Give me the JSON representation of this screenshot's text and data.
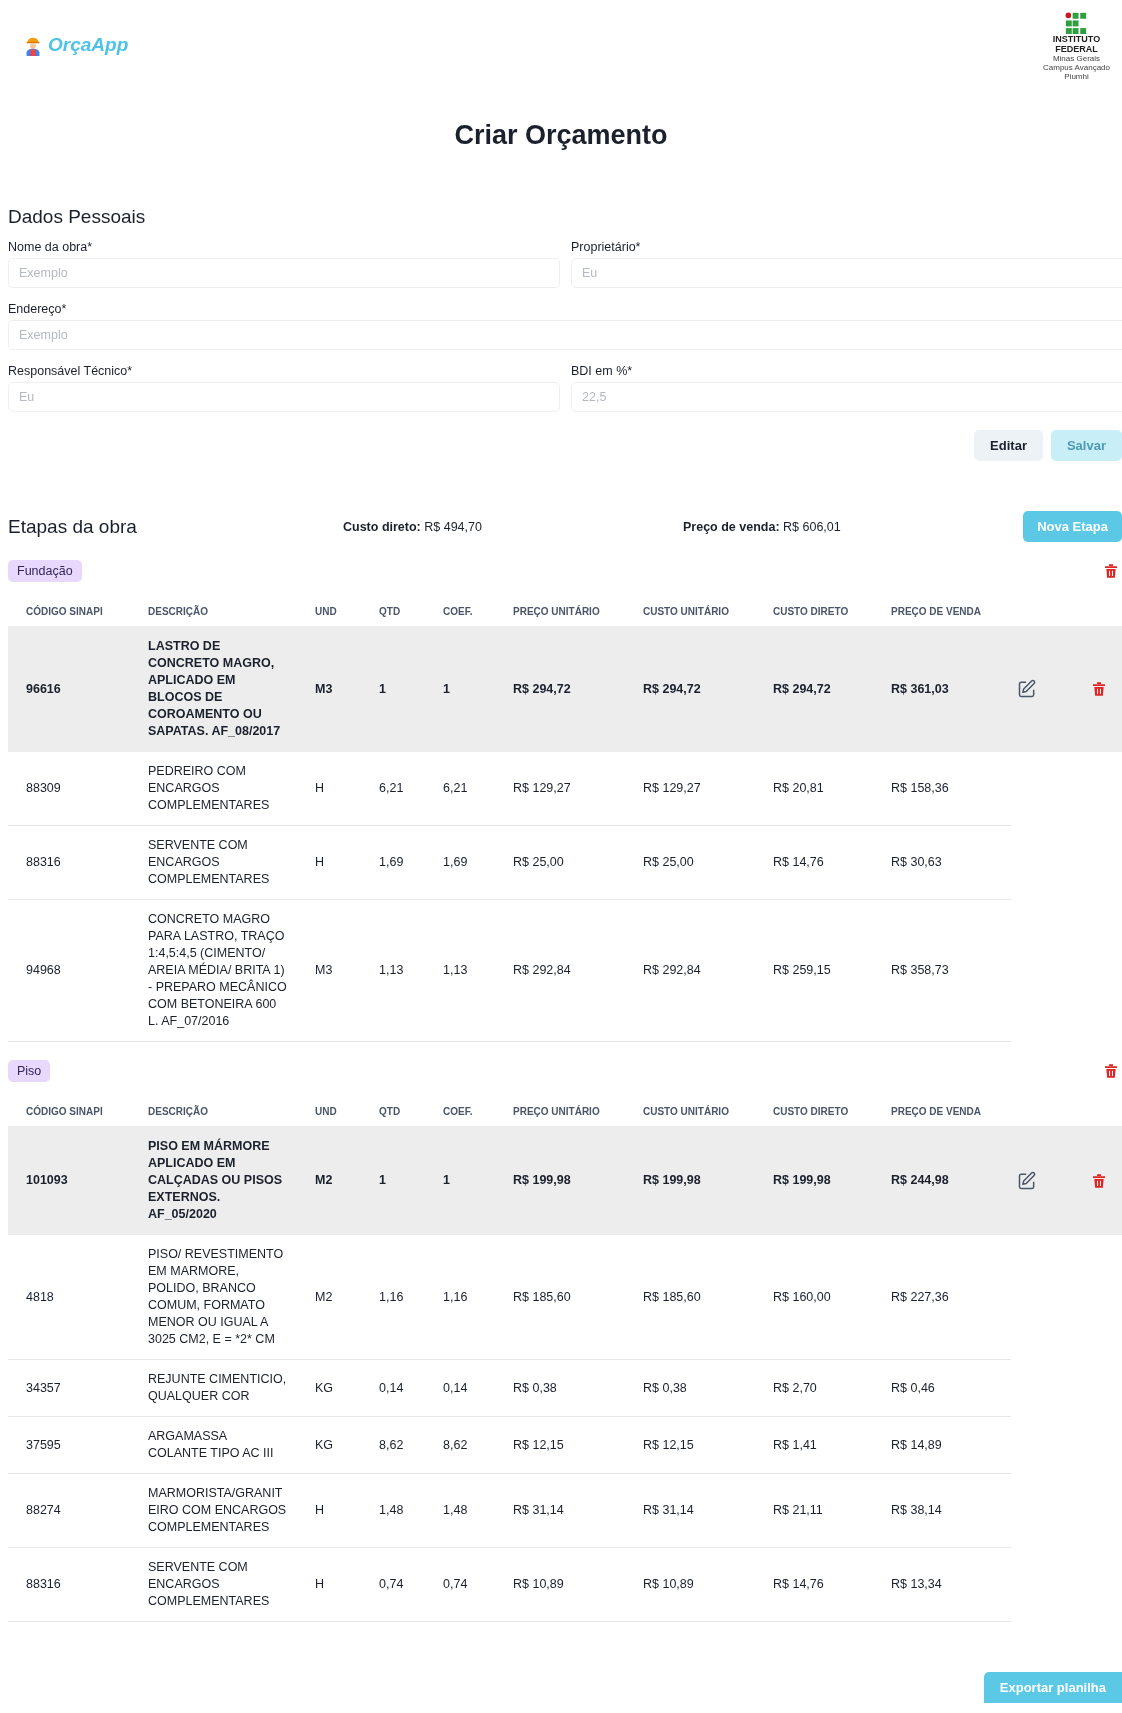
{
  "header": {
    "app_name": "OrçaApp",
    "institute": {
      "name": [
        "INSTITUTO",
        "FEDERAL"
      ],
      "lines": [
        "Minas Gerais",
        "Campus Avançado",
        "Piumhi"
      ]
    }
  },
  "title": "Criar Orçamento",
  "personal_data": {
    "heading": "Dados Pessoais",
    "fields": [
      {
        "label": "Nome da obra*",
        "placeholder": "Exemplo",
        "kind": "half"
      },
      {
        "label": "Proprietário*",
        "placeholder": "Eu",
        "kind": "half"
      },
      {
        "label": "Endereço*",
        "placeholder": "Exemplo",
        "kind": "full"
      },
      {
        "label": "Responsável Técnico*",
        "placeholder": "Eu",
        "kind": "half"
      },
      {
        "label": "BDI em %*",
        "placeholder": "22,5",
        "kind": "half"
      }
    ],
    "buttons": [
      {
        "label": "Editar",
        "disabled": false
      },
      {
        "label": "Salvar",
        "disabled": true
      }
    ]
  },
  "stages_section": {
    "heading": "Etapas da obra",
    "direct_cost": "**Custo direto:** R$ 494,70",
    "sale_price": "**Preço de venda:** R$ 606,01",
    "new_button": "Nova Etapa"
  },
  "stages": [
    {
      "name": "Fundação",
      "columns": [
        "CÓDIGO SINAPI",
        "DESCRIÇÃO",
        "UND",
        "QTD",
        "COEF.",
        "PREÇO UNITÁRIO",
        "CUSTO UNITÁRIO",
        "CUSTO DIRETO",
        "PREÇO DE VENDA"
      ],
      "rows": [
        {
          "kind": "composition",
          "cells": [
            "96616",
            "LASTRO DE CONCRETO MAGRO, APLICADO EM BLOCOS DE COROAMENTO OU SAPATAS. AF_08/2017",
            "M3",
            "1",
            "1",
            "R$ 294,72",
            "R$ 294,72",
            "R$ 294,72",
            "R$ 361,03"
          ]
        },
        {
          "kind": "input",
          "cells": [
            "88309",
            "PEDREIRO COM ENCARGOS COMPLEMENTARES",
            "H",
            "6,21",
            "6,21",
            "R$ 129,27",
            "R$ 129,27",
            "R$ 20,81",
            "R$ 158,36"
          ]
        },
        {
          "kind": "input",
          "cells": [
            "88316",
            "SERVENTE COM ENCARGOS COMPLEMENTARES",
            "H",
            "1,69",
            "1,69",
            "R$ 25,00",
            "R$ 25,00",
            "R$ 14,76",
            "R$ 30,63"
          ]
        },
        {
          "kind": "input",
          "cells": [
            "94968",
            "CONCRETO MAGRO PARA LASTRO, TRAÇO 1:4,5:4,5 (CIMENTO/ AREIA MÉDIA/ BRITA 1) - PREPARO MECÂNICO COM BETONEIRA 600 L. AF_07/2016",
            "M3",
            "1,13",
            "1,13",
            "R$ 292,84",
            "R$ 292,84",
            "R$ 259,15",
            "R$ 358,73"
          ]
        }
      ]
    },
    {
      "name": "Piso",
      "columns": [
        "CÓDIGO SINAPI",
        "DESCRIÇÃO",
        "UND",
        "QTD",
        "COEF.",
        "PREÇO UNITÁRIO",
        "CUSTO UNITÁRIO",
        "CUSTO DIRETO",
        "PREÇO DE VENDA"
      ],
      "rows": [
        {
          "kind": "composition",
          "cells": [
            "101093",
            "PISO EM MÁRMORE APLICADO EM CALÇADAS OU PISOS EXTERNOS. AF_05/2020",
            "M2",
            "1",
            "1",
            "R$ 199,98",
            "R$ 199,98",
            "R$ 199,98",
            "R$ 244,98"
          ]
        },
        {
          "kind": "input",
          "cells": [
            "4818",
            "PISO/ REVESTIMENTO EM MARMORE, POLIDO, BRANCO COMUM, FORMATO MENOR OU IGUAL A 3025 CM2, E = *2* CM",
            "M2",
            "1,16",
            "1,16",
            "R$ 185,60",
            "R$ 185,60",
            "R$ 160,00",
            "R$ 227,36"
          ]
        },
        {
          "kind": "input",
          "cells": [
            "34357",
            "REJUNTE CIMENTICIO, QUALQUER COR",
            "KG",
            "0,14",
            "0,14",
            "R$ 0,38",
            "R$ 0,38",
            "R$ 2,70",
            "R$ 0,46"
          ]
        },
        {
          "kind": "input",
          "cells": [
            "37595",
            "ARGAMASSA COLANTE TIPO AC III",
            "KG",
            "8,62",
            "8,62",
            "R$ 12,15",
            "R$ 12,15",
            "R$ 1,41",
            "R$ 14,89"
          ]
        },
        {
          "kind": "input",
          "cells": [
            "88274",
            "MARMORISTA/GRANIT EIRO COM ENCARGOS COMPLEMENTARES",
            "H",
            "1,48",
            "1,48",
            "R$ 31,14",
            "R$ 31,14",
            "R$ 21,11",
            "R$ 38,14"
          ]
        },
        {
          "kind": "input",
          "cells": [
            "88316",
            "SERVENTE COM ENCARGOS COMPLEMENTARES",
            "H",
            "0,74",
            "0,74",
            "R$ 10,89",
            "R$ 10,89",
            "R$ 14,76",
            "R$ 13,34"
          ]
        }
      ]
    }
  ],
  "export_button": "Exportar planilha"
}
